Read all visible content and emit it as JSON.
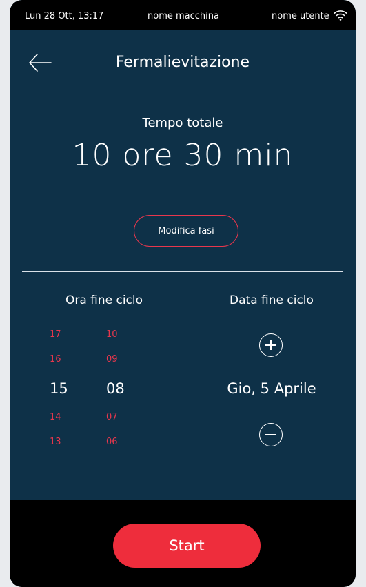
{
  "status_bar": {
    "datetime": "Lun 28 Ott, 13:17",
    "machine_name": "nome macchina",
    "user_name": "nome utente",
    "wifi_icon": "wifi-icon"
  },
  "header": {
    "back_icon": "arrow-left-icon",
    "title": "Fermalievitazione"
  },
  "total_time": {
    "label": "Tempo totale",
    "value": "10 ore 30 min"
  },
  "edit_phases_label": "Modifica fasi",
  "end_time": {
    "label": "Ora fine ciclo",
    "hours": [
      "17",
      "16",
      "15",
      "14",
      "13"
    ],
    "minutes": [
      "10",
      "09",
      "08",
      "07",
      "06"
    ],
    "selected_hour": "15",
    "selected_minute": "08"
  },
  "end_date": {
    "label": "Data fine ciclo",
    "value": "Gio, 5 Aprile",
    "plus_icon": "plus-circle-icon",
    "minus_icon": "minus-circle-icon"
  },
  "start_label": "Start",
  "colors": {
    "background": "#0e3148",
    "accent": "#ee2d3c",
    "picker_inactive": "#e8374d",
    "bar": "#000000"
  }
}
